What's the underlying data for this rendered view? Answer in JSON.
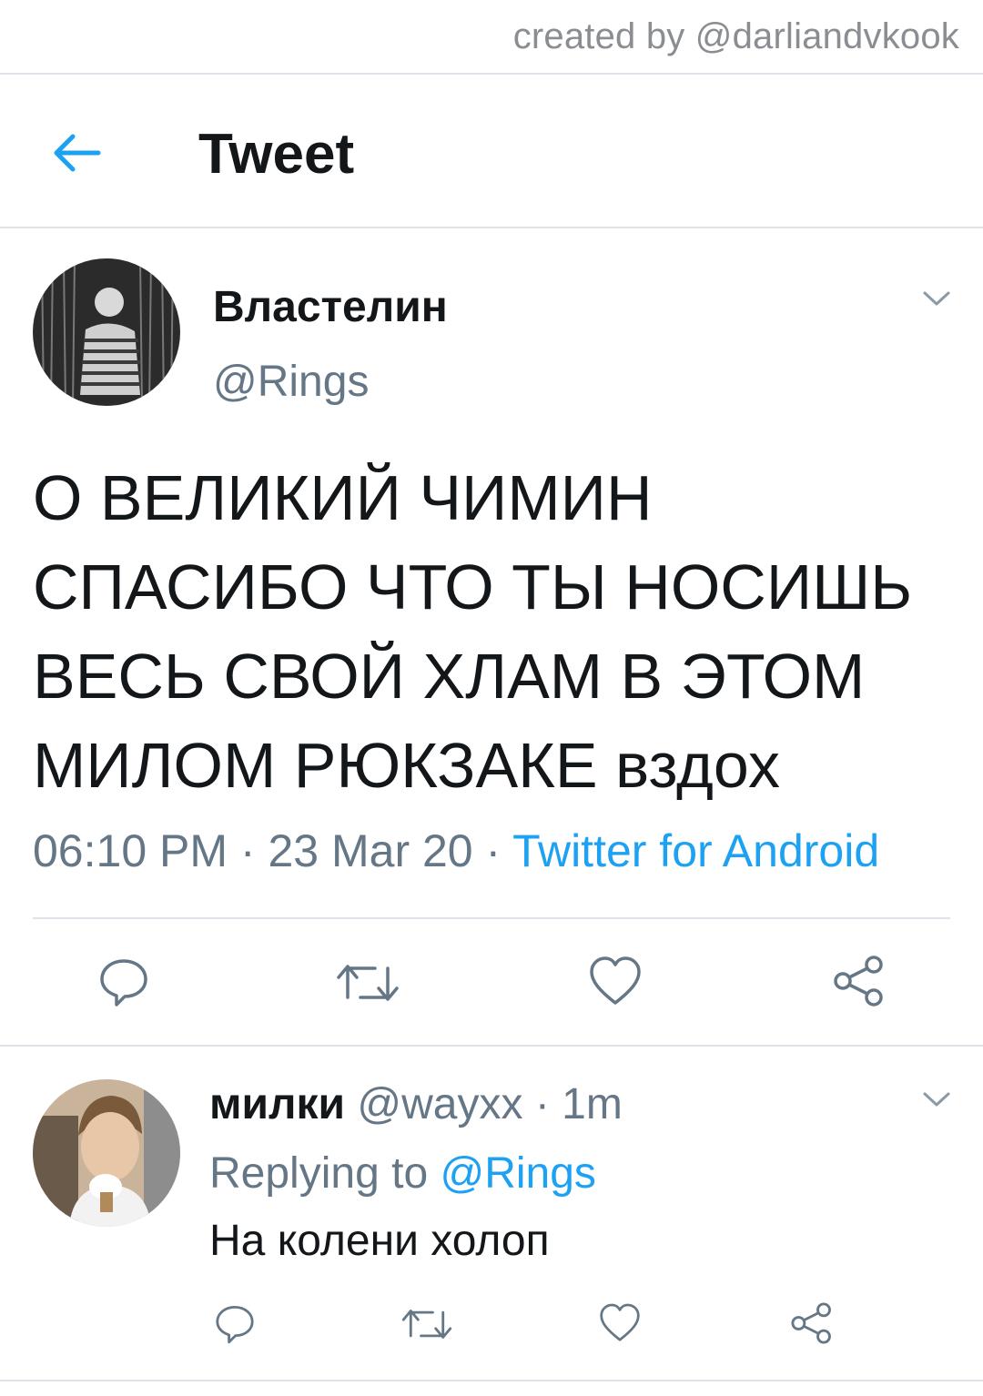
{
  "watermark": {
    "text": "created by @darliandvkook"
  },
  "header": {
    "title": "Tweet"
  },
  "tweet": {
    "display_name": "Властелин",
    "handle": "@Rings",
    "text": "О ВЕЛИКИЙ ЧИМИН СПАСИБО ЧТО ТЫ НОСИШЬ ВЕСЬ СВОЙ ХЛАМ В ЭТОМ МИЛОМ РЮКЗАКЕ вздох",
    "time": "06:10 PM",
    "separator": "·",
    "date": "23 Mar 20",
    "source": "Twitter for Android"
  },
  "reply": {
    "display_name": "милки",
    "handle": "@wayxx",
    "separator": "·",
    "time": "1m",
    "replying_prefix": "Replying to",
    "replying_to": "@Rings",
    "text": "На колени холоп"
  },
  "icons": {
    "back": "arrow-left-icon",
    "menu": "chevron-down-icon",
    "reply": "speech-bubble-icon",
    "retweet": "retweet-icon",
    "like": "heart-icon",
    "share": "share-icon"
  },
  "colors": {
    "accent": "#1da1f2",
    "text": "#14171a",
    "secondary": "#657786",
    "divider": "#dde3e8",
    "icon": "#657786"
  }
}
